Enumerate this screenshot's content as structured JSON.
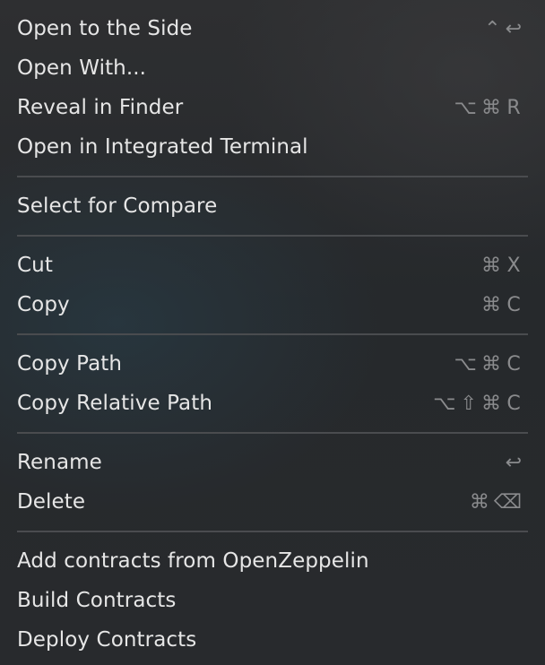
{
  "menu": {
    "groups": [
      {
        "items": [
          {
            "label": "Open to the Side",
            "keys": [
              "⌃",
              "↩"
            ]
          },
          {
            "label": "Open With...",
            "keys": []
          },
          {
            "label": "Reveal in Finder",
            "keys": [
              "⌥",
              "⌘",
              "R"
            ]
          },
          {
            "label": "Open in Integrated Terminal",
            "keys": []
          }
        ]
      },
      {
        "items": [
          {
            "label": "Select for Compare",
            "keys": []
          }
        ]
      },
      {
        "items": [
          {
            "label": "Cut",
            "keys": [
              "⌘",
              "X"
            ]
          },
          {
            "label": "Copy",
            "keys": [
              "⌘",
              "C"
            ]
          }
        ]
      },
      {
        "items": [
          {
            "label": "Copy Path",
            "keys": [
              "⌥",
              "⌘",
              "C"
            ]
          },
          {
            "label": "Copy Relative Path",
            "keys": [
              "⌥",
              "⇧",
              "⌘",
              "C"
            ]
          }
        ]
      },
      {
        "items": [
          {
            "label": "Rename",
            "keys": [
              "↩"
            ]
          },
          {
            "label": "Delete",
            "keys": [
              "⌘",
              "⌫"
            ]
          }
        ]
      },
      {
        "items": [
          {
            "label": "Add contracts from OpenZeppelin",
            "keys": []
          },
          {
            "label": "Build Contracts",
            "keys": []
          },
          {
            "label": "Deploy Contracts",
            "keys": []
          }
        ]
      }
    ]
  },
  "colors": {
    "background": "#27292c",
    "text": "#e6e6e6",
    "shortcut": "#8a8b8d",
    "separator": "#4a4c4f"
  }
}
